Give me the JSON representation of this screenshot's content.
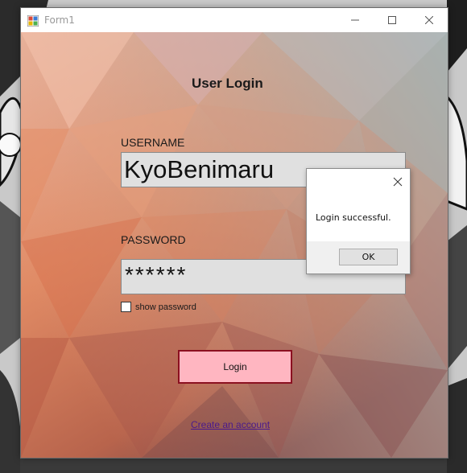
{
  "window": {
    "title": "Form1"
  },
  "form": {
    "heading": "User Login",
    "username_label": "USERNAME",
    "username_value": "KyoBenimaru",
    "password_label": "PASSWORD",
    "password_value": "******",
    "show_password_label": "show password",
    "show_password_checked": false,
    "login_button": "Login",
    "create_account_link": "Create an account"
  },
  "message_box": {
    "text": "Login successful.",
    "ok_button": "OK"
  },
  "icons": [
    "app-icon",
    "minimize-icon",
    "maximize-icon",
    "close-icon",
    "dialog-close-icon"
  ],
  "colors": {
    "login_button_bg": "#ffb6c1",
    "login_button_border": "#8b1020",
    "link": "#4a1a8c"
  }
}
